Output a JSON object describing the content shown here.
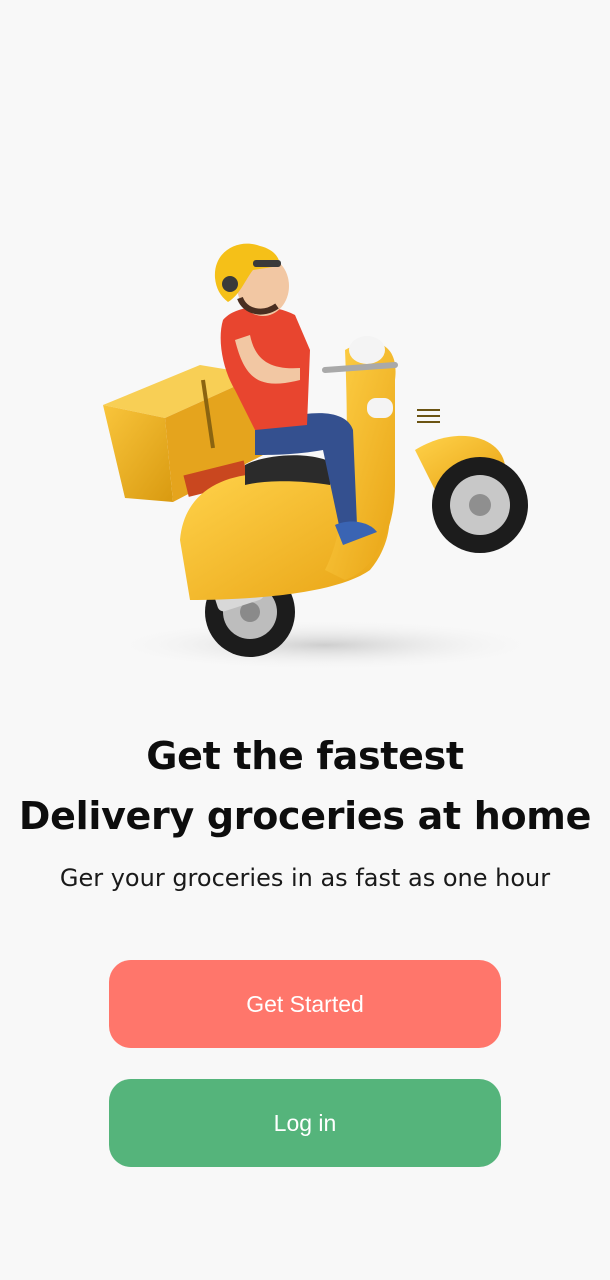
{
  "hero": {
    "illustration": "delivery-scooter-rider-illustration"
  },
  "headline": {
    "line1": "Get the fastest",
    "line2": "Delivery groceries at home"
  },
  "subtitle": "Ger your groceries in as fast as one hour",
  "actions": {
    "get_started_label": "Get Started",
    "login_label": "Log in"
  },
  "colors": {
    "background": "#f8f8f8",
    "primary_button": "#ff766b",
    "secondary_button": "#55b47b",
    "scooter_yellow": "#f5b81c",
    "shirt_red": "#e8452f",
    "pants_blue": "#34508f"
  }
}
